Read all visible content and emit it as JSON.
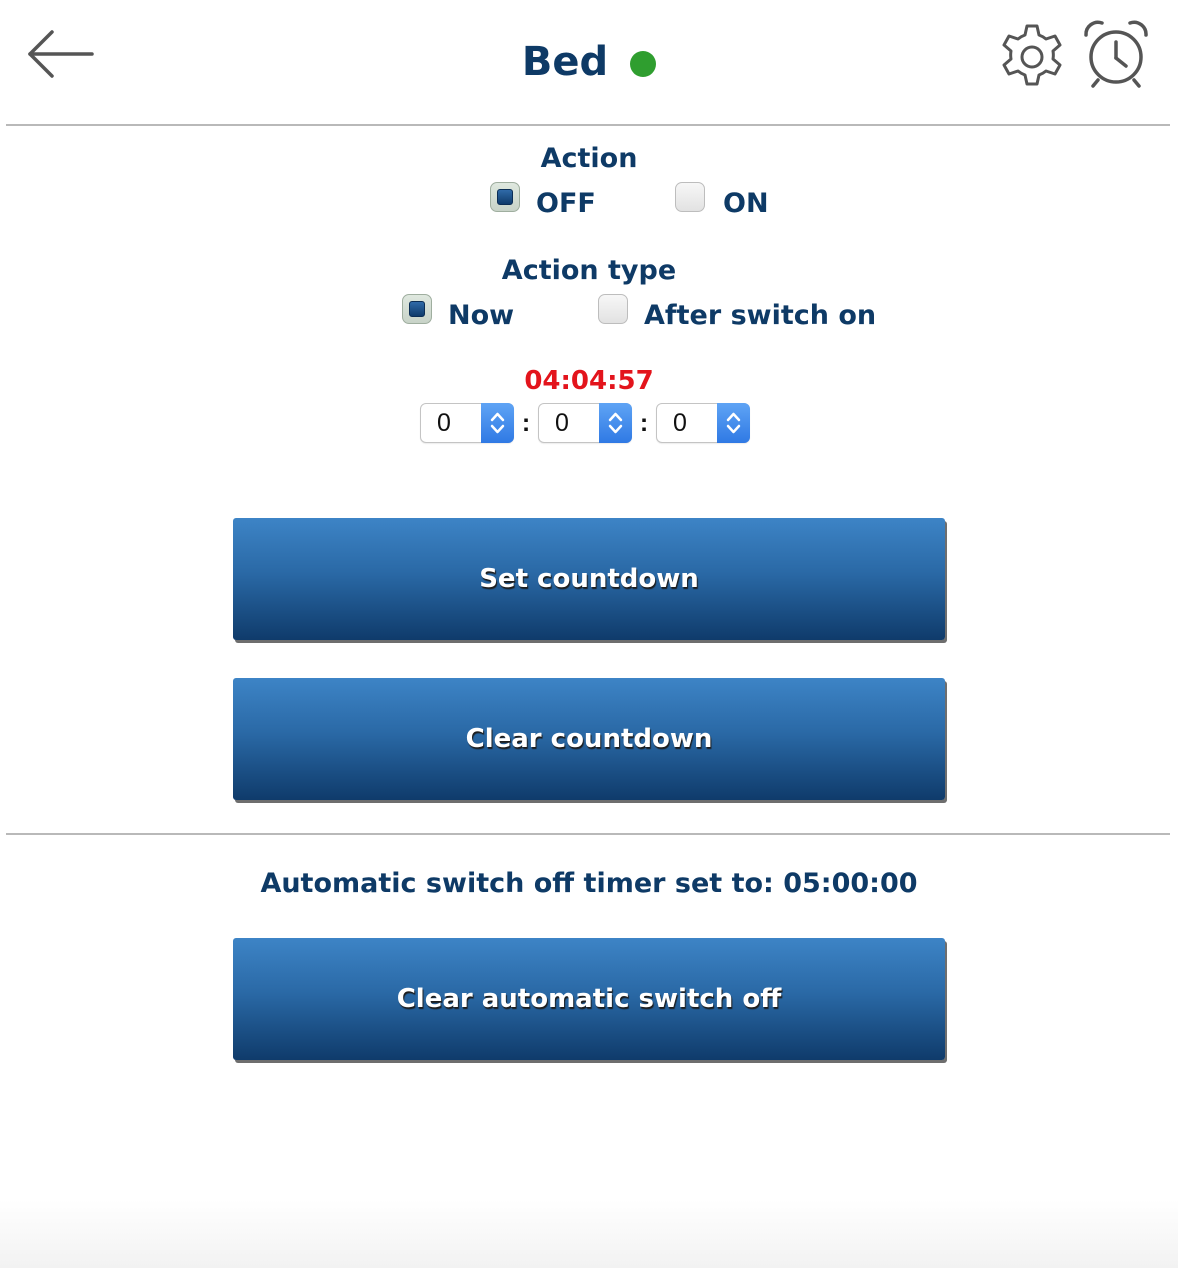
{
  "header": {
    "title": "Bed",
    "status_color": "#2f9e2f",
    "back_icon": "arrow-left-icon",
    "settings_icon": "gear-icon",
    "alarm_icon": "alarm-clock-icon"
  },
  "action": {
    "label": "Action",
    "options": [
      {
        "label": "OFF",
        "checked": true
      },
      {
        "label": "ON",
        "checked": false
      }
    ]
  },
  "action_type": {
    "label": "Action type",
    "options": [
      {
        "label": "Now",
        "checked": true
      },
      {
        "label": "After switch on",
        "checked": false
      }
    ]
  },
  "timer": {
    "countdown": "04:04:57",
    "countdown_color": "#e3141c",
    "hours": "0",
    "minutes": "0",
    "seconds": "0",
    "separator": ":"
  },
  "buttons": {
    "set_countdown": "Set countdown",
    "clear_countdown": "Clear countdown",
    "clear_auto_off": "Clear automatic switch off"
  },
  "auto_off": {
    "text": "Automatic switch off timer set to: 05:00:00"
  },
  "colors": {
    "primary_text": "#0e3a66",
    "button_top": "#3d84c6",
    "button_bottom": "#0f3b6b"
  }
}
